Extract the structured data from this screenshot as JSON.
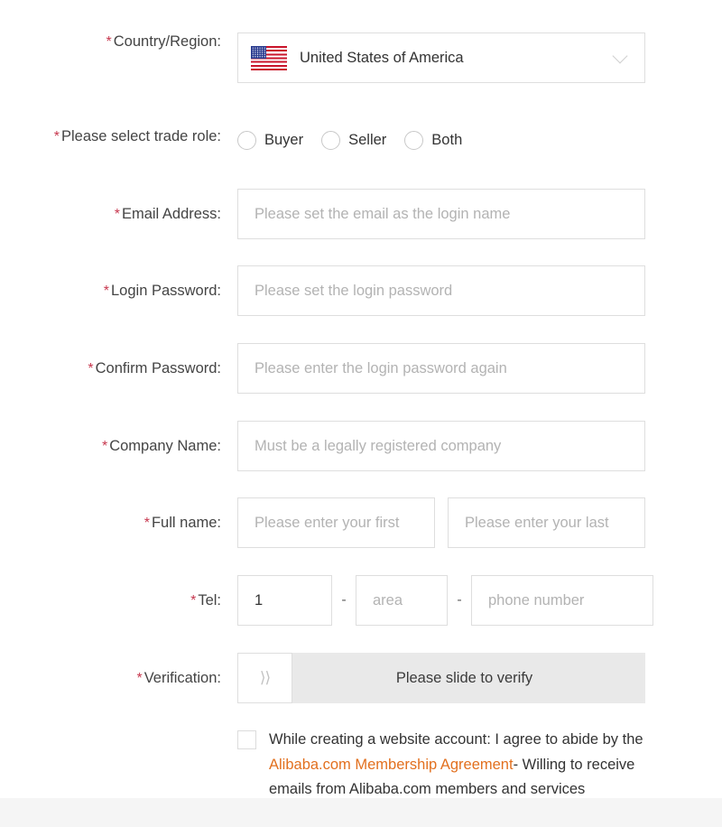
{
  "form": {
    "country": {
      "label": "Country/Region:",
      "required_mark": "*",
      "selected": "United States of America",
      "flag_icon": "us-flag-icon",
      "chevron_icon": "chevron-down-icon"
    },
    "trade_role": {
      "label": "Please select trade role:",
      "required_mark": "*",
      "options": [
        {
          "label": "Buyer",
          "selected": false
        },
        {
          "label": "Seller",
          "selected": false
        },
        {
          "label": "Both",
          "selected": false
        }
      ]
    },
    "email": {
      "label": "Email Address:",
      "required_mark": "*",
      "placeholder": "Please set the email as the login name",
      "value": ""
    },
    "login_password": {
      "label": "Login Password:",
      "required_mark": "*",
      "placeholder": "Please set the login password",
      "value": ""
    },
    "confirm_password": {
      "label": "Confirm Password:",
      "required_mark": "*",
      "placeholder": "Please enter the login password again",
      "value": ""
    },
    "company_name": {
      "label": "Company Name:",
      "required_mark": "*",
      "placeholder": "Must be a legally registered company",
      "value": ""
    },
    "full_name": {
      "label": "Full name:",
      "required_mark": "*",
      "first_placeholder": "Please enter your first",
      "first_value": "",
      "last_placeholder": "Please enter your last",
      "last_value": ""
    },
    "tel": {
      "label": "Tel:",
      "required_mark": "*",
      "country_code_value": "1",
      "country_code_placeholder": "",
      "separator": "-",
      "area_placeholder": "area",
      "area_value": "",
      "number_placeholder": "phone number",
      "number_value": ""
    },
    "verification": {
      "label": "Verification:",
      "required_mark": "*",
      "handle_icon": "double-chevron-right-icon",
      "handle_glyph": "⟩⟩",
      "track_text": "Please slide to verify"
    },
    "agreement": {
      "checked": false,
      "text_before": "While creating a website account: I agree to abide by the ",
      "link_text": "Alibaba.com Membership Agreement",
      "text_after": "- Willing to receive emails from Alibaba.com members and services"
    }
  },
  "colors": {
    "required_asterisk": "#c7384f",
    "label_text": "#444444",
    "placeholder_text": "#b3b3b3",
    "value_text": "#333333",
    "field_border": "#dedede",
    "link_orange": "#e2701f",
    "slider_track": "#e9e9e9",
    "page_background": "#ffffff",
    "footer_band": "#f5f5f5"
  }
}
